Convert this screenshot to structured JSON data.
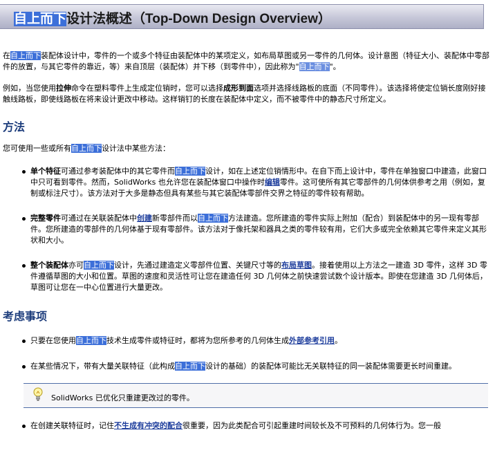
{
  "header": {
    "title_hl": "自上而下",
    "title_rest": "设计法概述（Top-Down Design Overview）"
  },
  "para1": {
    "t1": "在",
    "hl1": "自上而下",
    "t2": "装配体设计中，零件的一个或多个特征由装配体中的某项定义，如布局草图或另一零件的几何体。设计意图（特征大小、装配体中零部件的放置，与其它零件的靠近，等）来自顶层（装配体）并下移（到零件中），因此称为\"",
    "hl2": "自上而下",
    "t3": "\"。"
  },
  "para2": {
    "t1": "例如，当您使用",
    "b1": "拉伸",
    "t2": "命令在塑料零件上生成定位销时，您可以选择",
    "b2": "成形到面",
    "t3": "选项并选择线路板的底面（不同零件）。该选择将使定位销长度刚好接触线路板，即使线路板在将来设计更改中移动。这样销钉的长度在装配体中定义，而不被零件中的静态尺寸所定义。"
  },
  "methods": {
    "heading": "方法",
    "intro_t1": "您可使用一些或所有",
    "intro_hl": "自上而下",
    "intro_t2": "设计法中某些方法：",
    "item1": {
      "bold": "单个特征",
      "t1": "可通过参考装配体中的其它零件而",
      "hl": "自上而下",
      "t2": "设计，如在上述定位销情形中。在自下而上设计中，零件在单独窗口中建造，此窗口中只可看到零件。然而，SolidWorks 也允许您在装配体窗口中操作时",
      "link": "编辑",
      "t3": "零件。这可使所有其它零部件的几何体供参考之用（例如，复制或标注尺寸）。该方法对于大多是静态但具有某些与其它装配体零部件交界之特征的零件较有帮助。"
    },
    "item2": {
      "bold": "完整零件",
      "t1": "可通过在关联装配体中",
      "link": "创建",
      "t2": "新零部件而以",
      "hl": "自上而下",
      "t3": "方法建造。您所建造的零件实际上附加（配合）到装配体中的另一现有零部件。您所建造的零部件的几何体基于现有零部件。该方法对于像托架和器具之类的零件较有用，它们大多或完全依赖其它零件来定义其形状和大小。"
    },
    "item3": {
      "bold": "整个装配体",
      "t1": "亦可",
      "hl": "自上而下",
      "t2": "设计，先通过建造定义零部件位置、关键尺寸等的",
      "link": "布局草图",
      "t3": "。接着使用以上方法之一建造 3D 零件，这样 3D 零件遵循草图的大小和位置。草图的速度和灵活性可让您在建造任何 3D 几何体之前快速尝试数个设计版本。即使在您建造 3D 几何体后，草图可让您在一中心位置进行大量更改。"
    }
  },
  "considerations": {
    "heading": "考虑事项",
    "item1": {
      "t1": "只要在您使用",
      "hl": "自上而下",
      "t2": "技术生成零件或特征时，都将为您所参考的几何体生成",
      "link": "外部参考引用",
      "t3": "。"
    },
    "item2": {
      "t1": "在某些情况下，带有大量关联特征（此构成",
      "hl": "自上而下",
      "t2": "设计的基础）的装配体可能比无关联特征的同一装配体需要更长时间重建。"
    },
    "note": "SolidWorks 已优化只重建更改过的零件。",
    "item3": {
      "t1": "在创建关联特征时，记住",
      "link": "不生成有冲突的配合",
      "t2": "很重要，因为此类配合可引起重建时间较长及不可预料的几何体行为。您一般"
    }
  },
  "icons": {
    "note": "lightbulb-icon"
  },
  "colors": {
    "highlight": "#3c6fd9",
    "heading": "#1d3d7c",
    "link": "#1d3d9c"
  }
}
